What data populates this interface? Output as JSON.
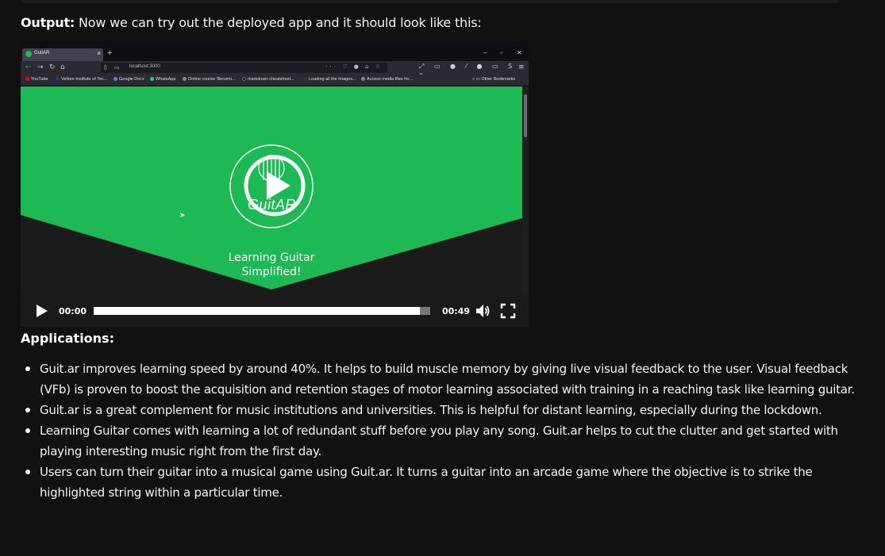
{
  "output": {
    "label": "Output:",
    "text": " Now we can try out the deployed app and it should look like this:"
  },
  "browser": {
    "tab_title": "GuitAR",
    "tab_close": "×",
    "new_tab": "+",
    "url": "localhost:3000",
    "bookmarks": [
      {
        "label": "YouTube",
        "color": "#ff0000"
      },
      {
        "label": "Vellore Institute of Tec...",
        "color": "#1e3a8a"
      },
      {
        "label": "Google Docs",
        "color": "#4285f4"
      },
      {
        "label": "WhatsApp",
        "color": "#25d366"
      },
      {
        "label": "Online course 'Becomi...",
        "color": "#888888"
      },
      {
        "label": "markdown-cheatsheet...",
        "color": "#111111"
      },
      {
        "label": "Loading all the images...",
        "color": "#333333"
      },
      {
        "label": "Access media files fro...",
        "color": "#888888"
      }
    ],
    "other_bookmarks": "Other Bookmarks"
  },
  "app_page": {
    "logo_text": "GuitAR",
    "tagline_line1": "Learning Guitar",
    "tagline_line2": "Simplified!",
    "brand_color": "#1db954"
  },
  "player": {
    "current_time": "00:00",
    "duration": "00:49",
    "progress_fraction": 0.97
  },
  "applications": {
    "heading": "Applications:",
    "items": [
      "Guit.ar improves learning speed by around 40%. It helps to build muscle memory by giving live visual feedback to the user. Visual feedback (VFb) is proven to boost the acquisition and retention stages of motor learning associated with training in a reaching task like learning guitar.",
      "Guit.ar is a great complement for music institutions and universities. This is helpful for distant learning, especially during the lockdown.",
      "Learning Guitar comes with learning a lot of redundant stuff before you play any song. Guit.ar helps to cut the clutter and get started with playing interesting music right from the first day.",
      "Users can turn their guitar into a musical game using Guit.ar. It turns a guitar into an arcade game where the objective is to strike the highlighted string within a particular time."
    ]
  }
}
